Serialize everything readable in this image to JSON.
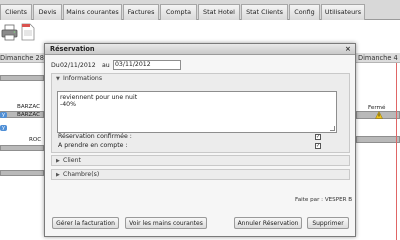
{
  "topnav": {
    "tabs": [
      "Clients",
      "Devis",
      "Mains courantes",
      "Factures",
      "Compta",
      "Stat Hotel",
      "Stat Clients",
      "Config",
      "Utilisateurs"
    ]
  },
  "toolbar": {
    "icons": [
      "printer-icon",
      "document-icon"
    ]
  },
  "planning": {
    "left_day": "Dimanche 28",
    "right_day": "Dimanche 4",
    "rows": {
      "barzac_1": "BARZAC",
      "barzac_2": "BARZAC",
      "roc": "ROC",
      "ferme": "Fermé"
    }
  },
  "dialog": {
    "title": "Réservation",
    "close": "×",
    "date_from_label": "Du",
    "date_from": "02/11/2012",
    "date_au_label": "au",
    "date_to": "03/11/2012",
    "sections": {
      "informations": "Informations",
      "client": "Client",
      "chambres": "Chambre(s)"
    },
    "comment": "reviennent pour une nuit\n-40%",
    "reservation_confirmee_label": "Réservation confirmée :",
    "reservation_confirmee_checked": "✓",
    "a_prendre_label": "A prendre en compte :",
    "a_prendre_checked": "✓",
    "fait_par": "Faite par : VESPER B",
    "buttons": {
      "facturation": "Gérer la facturation",
      "mains_courantes": "Voir les mains courantes",
      "annuler": "Annuler Réservation",
      "supprimer": "Supprimer"
    }
  }
}
